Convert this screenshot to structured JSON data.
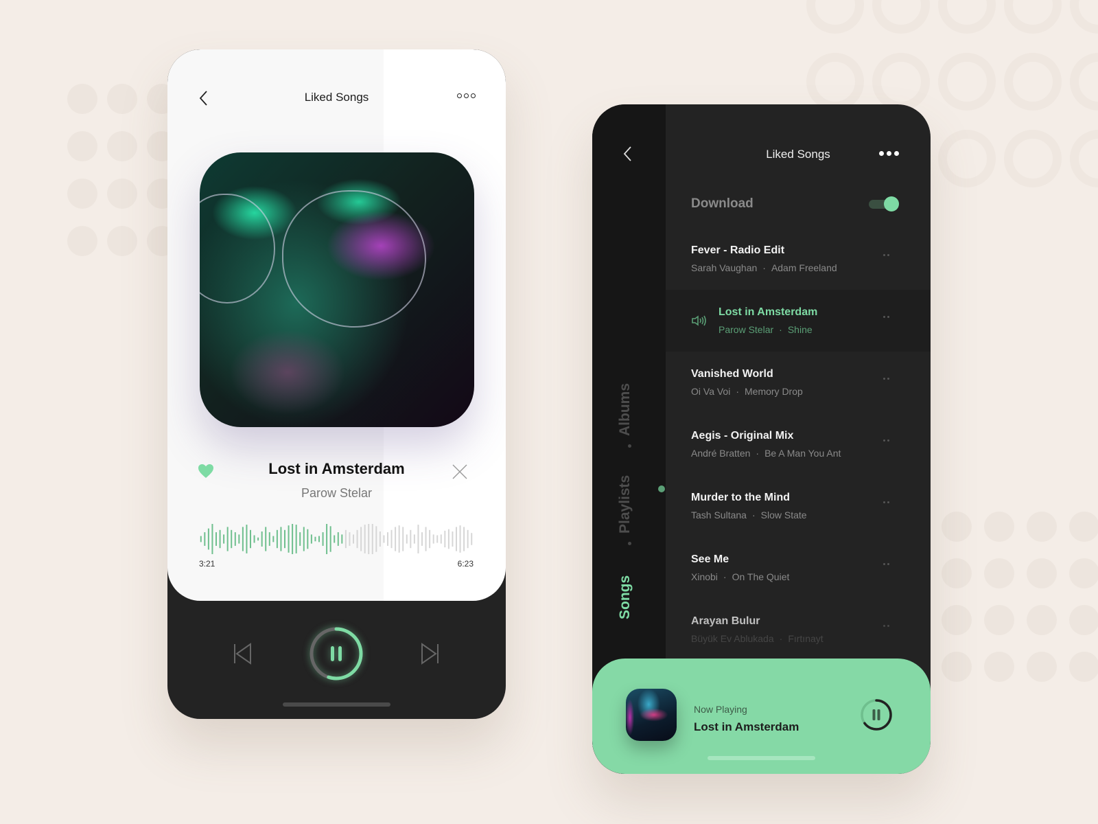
{
  "player": {
    "header": {
      "title": "Liked Songs",
      "back_icon": "chevron-left-icon",
      "more_icon": "more-horizontal-icon"
    },
    "track": {
      "title": "Lost in Amsterdam",
      "artist": "Parow Stelar",
      "liked": true
    },
    "progress": {
      "current": "3:21",
      "total": "6:23",
      "fraction": 0.53
    },
    "waveform_heights": [
      0.2,
      0.45,
      0.7,
      1,
      0.45,
      0.6,
      0.3,
      0.8,
      0.6,
      0.45,
      0.3,
      0.8,
      0.95,
      0.6,
      0.25,
      0.1,
      0.5,
      0.8,
      0.45,
      0.2,
      0.6,
      0.8,
      0.6,
      0.9,
      1,
      0.95,
      0.45,
      0.8,
      0.65,
      0.3,
      0.15,
      0.2,
      0.45,
      1,
      0.85,
      0.25,
      0.45,
      0.3,
      0.6,
      0.45,
      0.3,
      0.6,
      0.8,
      0.95,
      1,
      1,
      0.85,
      0.5,
      0.25,
      0.45,
      0.6,
      0.8,
      0.9,
      0.8,
      0.3,
      0.6,
      0.3,
      0.95,
      0.45,
      0.8,
      0.6,
      0.3,
      0.25,
      0.3,
      0.55,
      0.65,
      0.5,
      0.8,
      0.9,
      0.8,
      0.6,
      0.4
    ],
    "controls": {
      "prev_icon": "skip-back-icon",
      "play_icon": "pause-icon",
      "next_icon": "skip-forward-icon",
      "play_progress": 0.55
    },
    "accent": "#7edba4"
  },
  "library": {
    "header": {
      "title": "Liked Songs"
    },
    "tabs": [
      {
        "label": "Songs",
        "active": true
      },
      {
        "label": "Playlists",
        "active": false
      },
      {
        "label": "Albums",
        "active": false
      }
    ],
    "download": {
      "label": "Download",
      "enabled": true
    },
    "songs": [
      {
        "title": "Fever - Radio Edit",
        "artist": "Sarah Vaughan",
        "album": "Adam Freeland",
        "playing": false
      },
      {
        "title": "Lost in Amsterdam",
        "artist": "Parow Stelar",
        "album": "Shine",
        "playing": true
      },
      {
        "title": "Vanished World",
        "artist": "Oi Va Voi",
        "album": "Memory Drop",
        "playing": false
      },
      {
        "title": "Aegis - Original Mix",
        "artist": "André Bratten",
        "album": "Be A Man You Ant",
        "playing": false
      },
      {
        "title": "Murder to the Mind",
        "artist": "Tash Sultana",
        "album": "Slow State",
        "playing": false
      },
      {
        "title": "See Me",
        "artist": "Xinobi",
        "album": "On The Quiet",
        "playing": false
      },
      {
        "title": "Arayan Bulur",
        "artist": "Büyük Ev Ablukada",
        "album": "Fırtınayt",
        "playing": false
      }
    ],
    "now_playing": {
      "label": "Now Playing",
      "title": "Lost in Amsterdam",
      "progress": 0.65
    },
    "accent": "#85d9a6"
  }
}
